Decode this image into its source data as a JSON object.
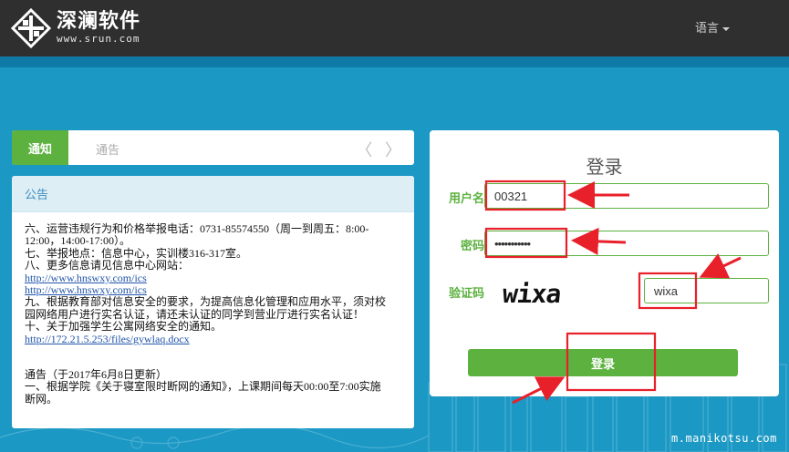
{
  "header": {
    "brand_name": "深澜软件",
    "brand_url": "www.srun.com",
    "language_label": "语言"
  },
  "tabs": {
    "active_label": "通知",
    "second_label": "通告",
    "arrows": "〈 〉"
  },
  "notice_panel": {
    "title": "公告",
    "lines": [
      "六、运营违规行为和价格举报电话：0731-85574550（周一到周五：8:00-",
      "12:00，14:00-17:00）。",
      "七、举报地点：信息中心，实训楼316-317室。",
      "八、更多信息请见信息中心网站："
    ],
    "links": [
      "http://www.hnswxy.com/ics",
      "http://www.hnswxy.com/ics"
    ],
    "lines2": [
      "九、根据教育部对信息安全的要求，为提高信息化管理和应用水平，须对校",
      "园网络用户进行实名认证，请还未认证的同学到营业厅进行实名认证！",
      "十、关于加强学生公寓网络安全的通知。"
    ],
    "link3": "http://172.21.5.253/files/gywlaq.docx",
    "lines3": [
      "通告（于2017年6月8日更新）",
      "一、根据学院《关于寝室限时断网的通知》，上课期间每天00:00至7:00实施",
      "断网。"
    ]
  },
  "login": {
    "title": "登录",
    "username_label": "用户名",
    "username_value": "00321",
    "password_label": "密码",
    "password_value": "•••••••••••",
    "captcha_label": "验证码",
    "captcha_image_text": "wixa",
    "captcha_value": "wixa",
    "submit_label": "登录"
  },
  "watermark": "m.manikotsu.com",
  "colors": {
    "accent_green": "#5cb13f",
    "header_dark": "#2f2f2f",
    "background_blue": "#1b98c4",
    "annotation_red": "#e8202a"
  }
}
